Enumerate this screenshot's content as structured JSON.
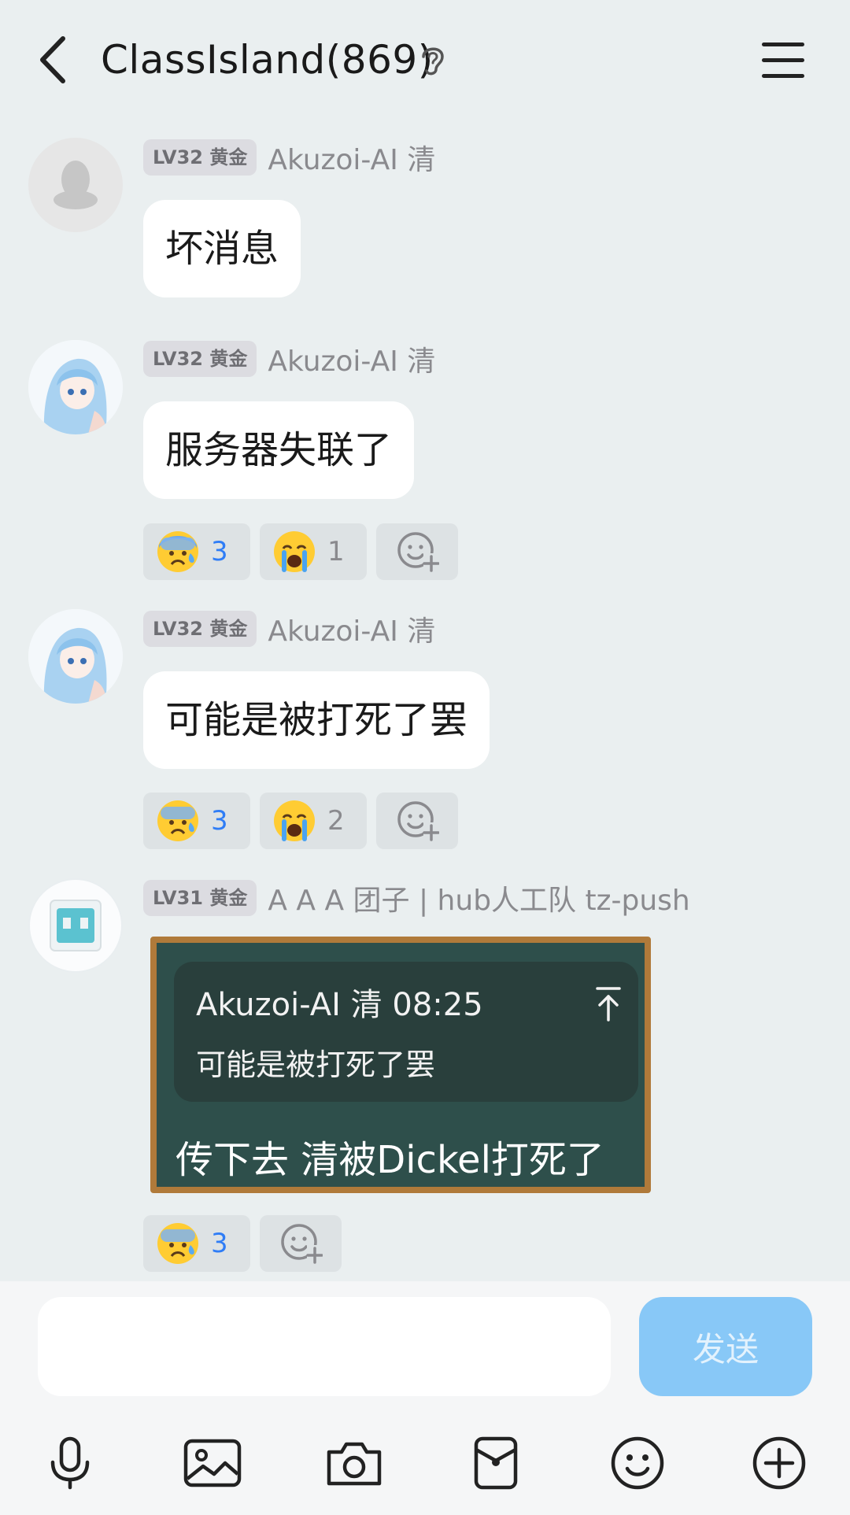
{
  "header": {
    "title": "ClassIsland(869)"
  },
  "messages": [
    {
      "level": "LV32 黄金",
      "sender": "Akuzoi-AI 清",
      "text": "坏消息"
    },
    {
      "level": "LV32 黄金",
      "sender": "Akuzoi-AI 清",
      "text": "服务器失联了",
      "reactions": [
        {
          "emoji": "anxious-face",
          "count": "3"
        },
        {
          "emoji": "crying-face",
          "count": "1"
        }
      ]
    },
    {
      "level": "LV32 黄金",
      "sender": "Akuzoi-AI 清",
      "text": "可能是被打死了罢",
      "reactions": [
        {
          "emoji": "anxious-face",
          "count": "3"
        },
        {
          "emoji": "crying-face",
          "count": "2"
        }
      ]
    },
    {
      "level": "LV31 黄金",
      "sender": "A A A 团子 | hub人工队 tz-push",
      "quote": {
        "meta": "Akuzoi-AI 清 08:25",
        "text": "可能是被打死了罢"
      },
      "text": "传下去 清被Dickel打死了",
      "reactions": [
        {
          "emoji": "anxious-face",
          "count": "3"
        }
      ]
    }
  ],
  "input": {
    "placeholder": "",
    "send_label": "发送"
  },
  "colors": {
    "background": "#eaeff0",
    "send_button": "#88c8f7",
    "reaction_count_active": "#2f7df6",
    "board_frame": "#b07a3a",
    "board_surface": "#2e4f4b"
  },
  "toolbar": [
    "microphone-icon",
    "image-icon",
    "camera-icon",
    "red-packet-icon",
    "emoji-icon",
    "plus-icon"
  ]
}
